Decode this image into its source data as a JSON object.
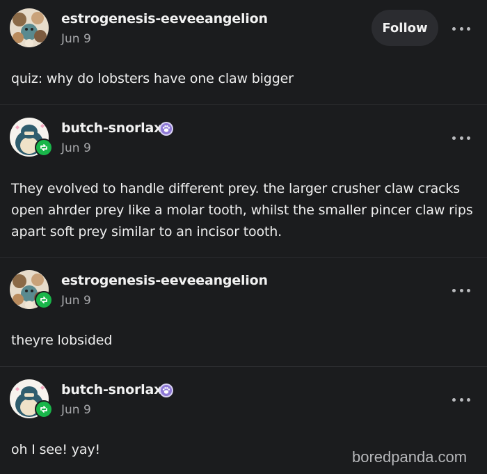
{
  "posts": [
    {
      "username": "estrogenesis-eeveeangelion",
      "date": "Jun 9",
      "body": "quiz: why do lobsters have one claw bigger",
      "follow_label": "Follow"
    },
    {
      "username": "butch-snorlax",
      "date": "Jun 9",
      "body": "They evolved to handle different prey. the larger crusher claw cracks open ahrder prey like a molar tooth, whilst the smaller pincer claw rips apart soft prey similar to an incisor tooth."
    },
    {
      "username": "estrogenesis-eeveeangelion",
      "date": "Jun 9",
      "body": "theyre lobsided"
    },
    {
      "username": "butch-snorlax",
      "date": "Jun 9",
      "body": "oh I see! yay!"
    }
  ],
  "watermark": "boredpanda.com",
  "colors": {
    "background": "#1b1c1e",
    "reblog_green": "#19b64a",
    "badge_purple": "#8e79d6"
  },
  "icons": [
    "eevee-avatar-icon",
    "snorlax-avatar-icon",
    "reblog-icon",
    "paw-badge-icon",
    "more-options-icon"
  ]
}
